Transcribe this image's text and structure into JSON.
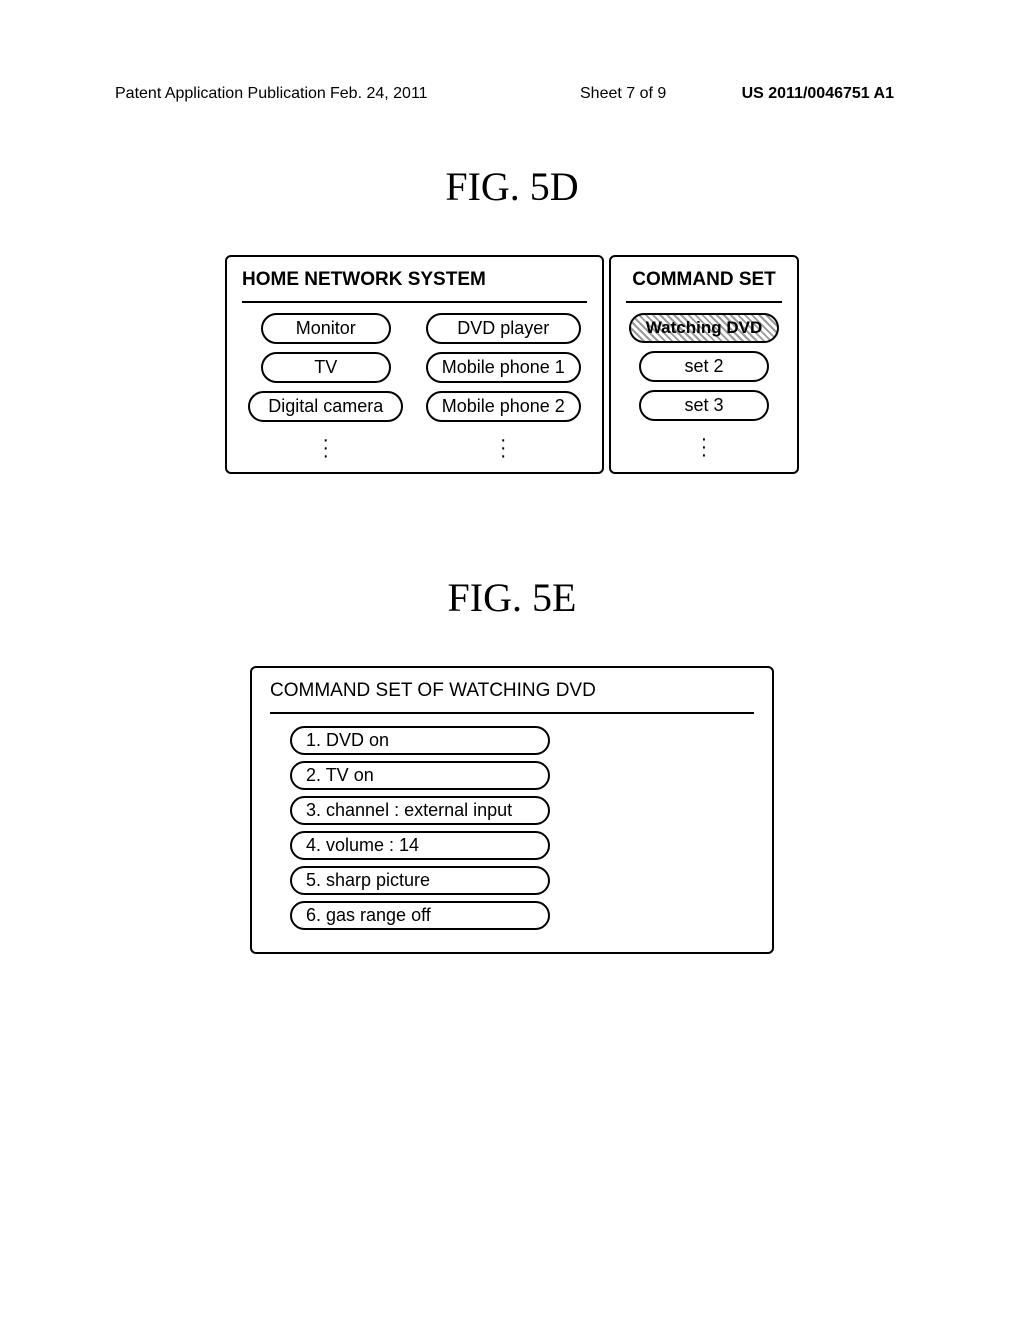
{
  "header": {
    "left": "Patent Application Publication",
    "center": "Feb. 24, 2011",
    "sheet": "Sheet 7 of 9",
    "pub_number": "US 2011/0046751 A1"
  },
  "fig5d": {
    "title": "FIG.  5D",
    "left_panel_title": "HOME NETWORK SYSTEM",
    "right_panel_title": "COMMAND SET",
    "devices_col1": [
      "Monitor",
      "TV",
      "Digital camera"
    ],
    "devices_col2": [
      "DVD player",
      "Mobile phone 1",
      "Mobile phone 2"
    ],
    "command_sets": [
      "Watching DVD",
      "set 2",
      "set 3"
    ]
  },
  "fig5e": {
    "title": "FIG.  5E",
    "panel_title": "COMMAND SET OF WATCHING DVD",
    "commands": [
      "1. DVD on",
      "2. TV on",
      "3. channel : external input",
      "4. volume : 14",
      "5. sharp picture",
      "6. gas range off"
    ]
  }
}
